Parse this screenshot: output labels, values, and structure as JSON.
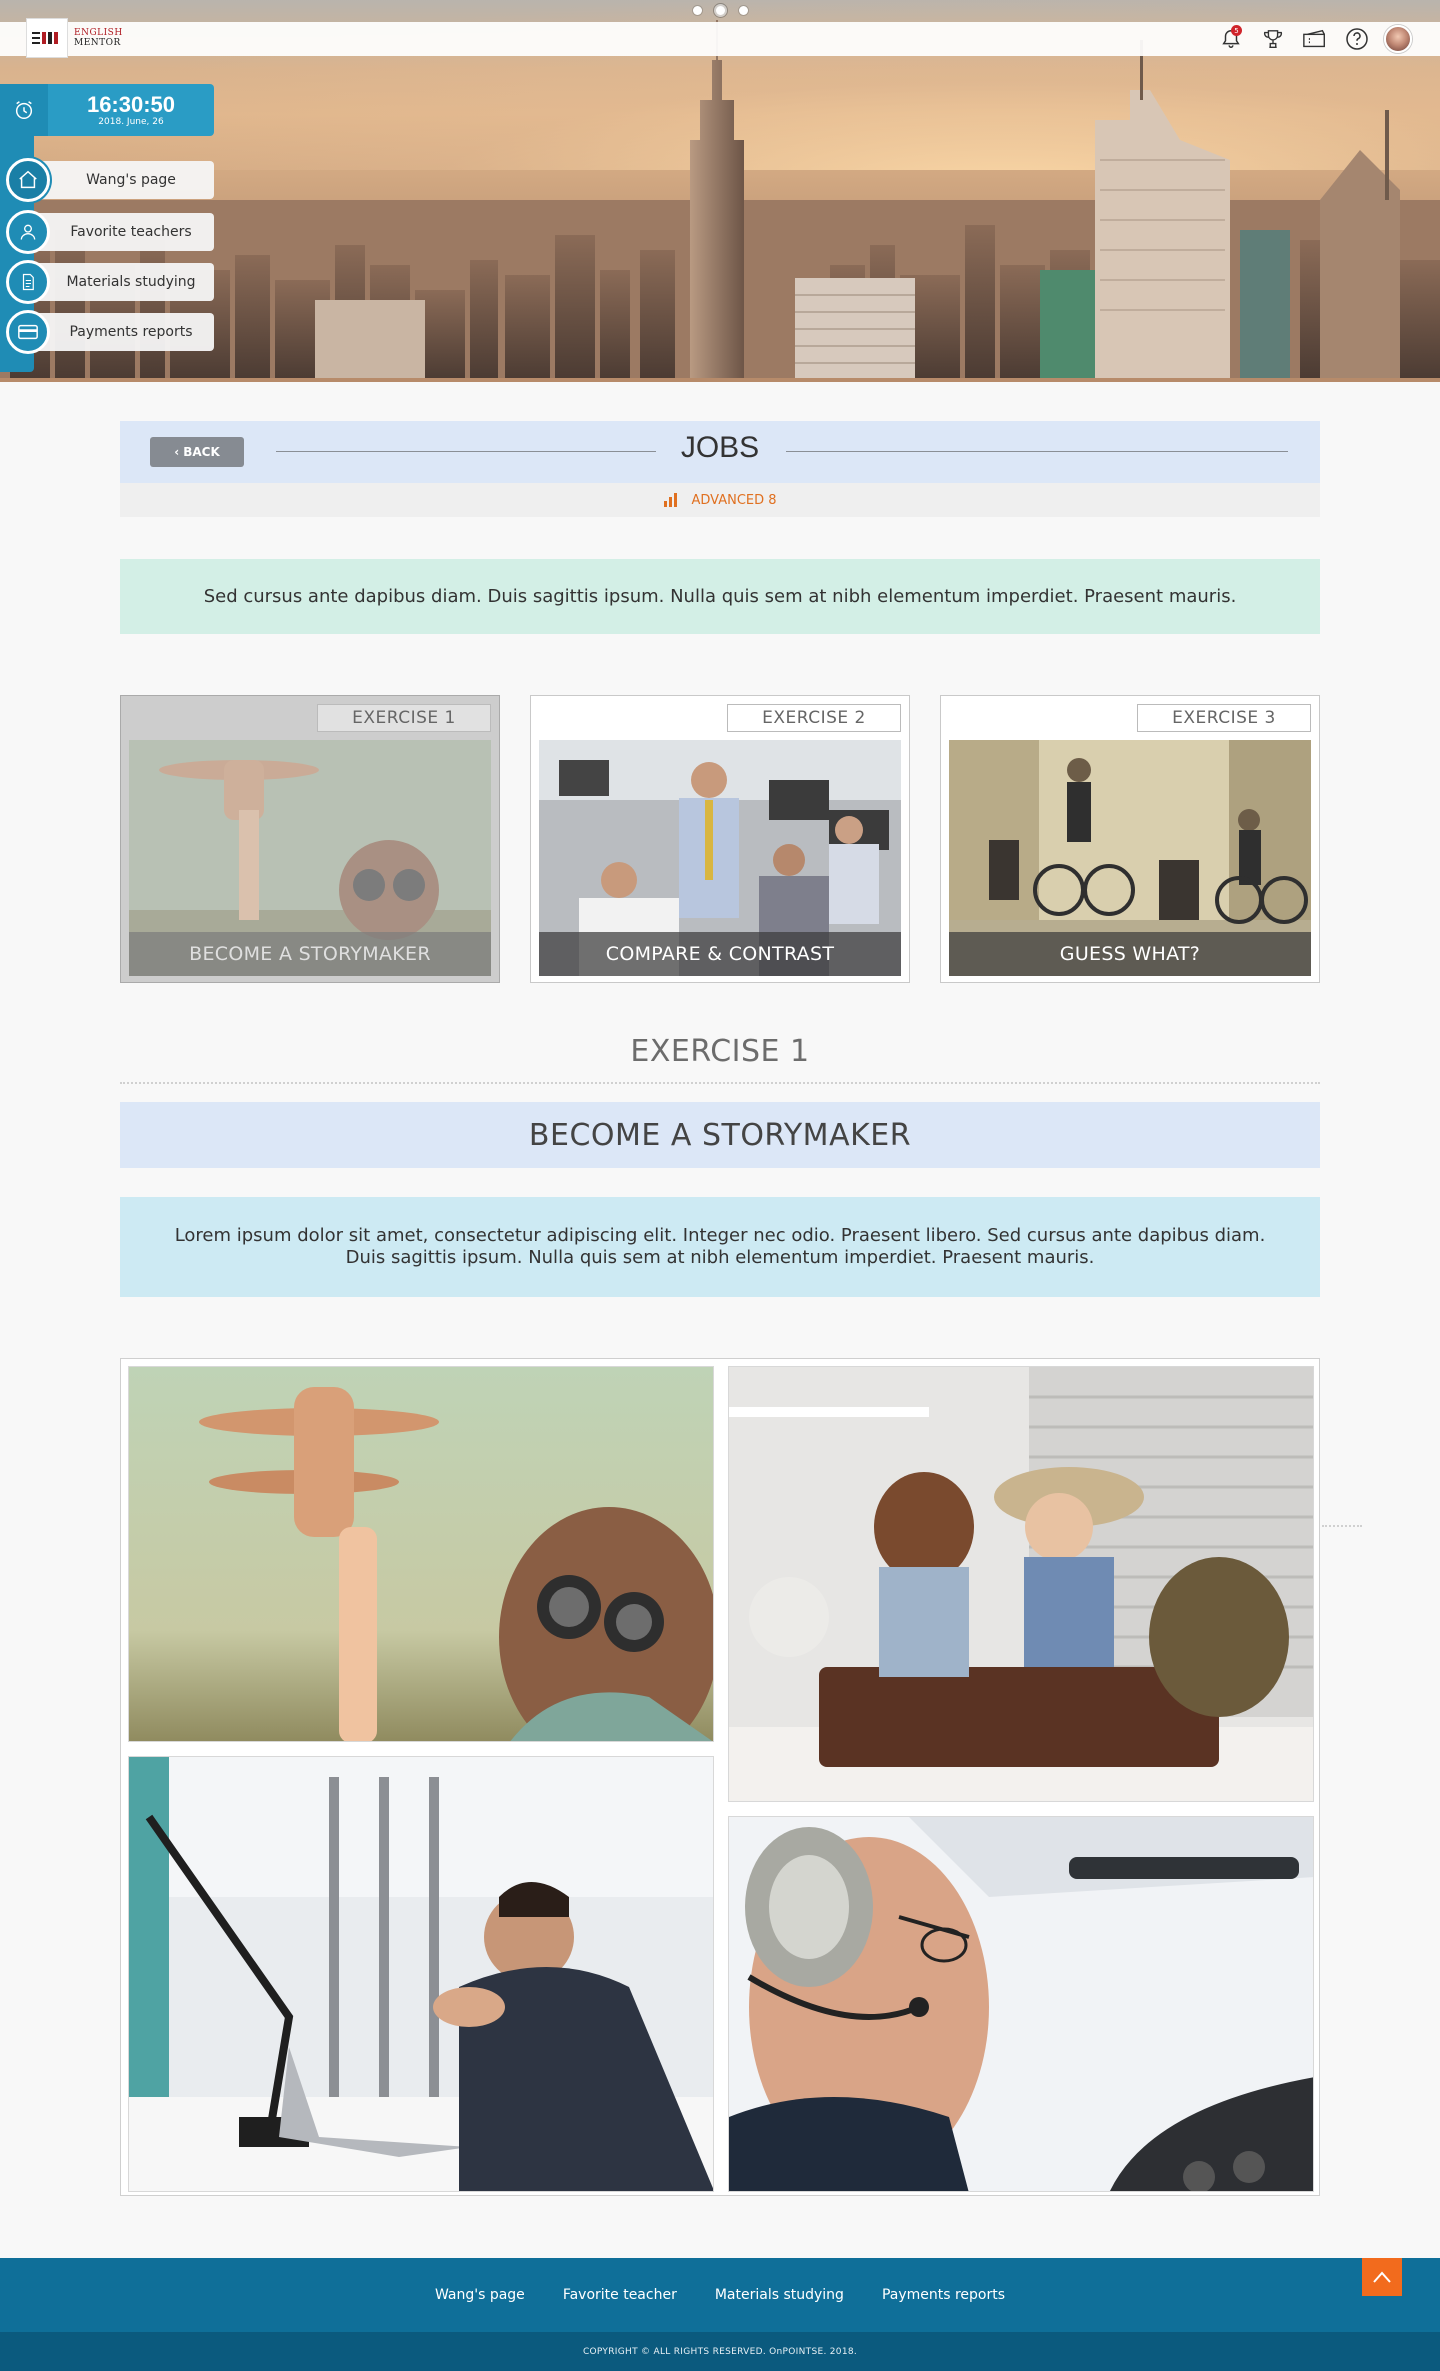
{
  "brand": {
    "line1": "ENGLISH",
    "line2": "MENTOR"
  },
  "header": {
    "notification_count": "5",
    "icons": [
      "bell-icon",
      "trophy-icon",
      "ticket-icon",
      "help-icon",
      "avatar"
    ]
  },
  "clock": {
    "time": "16:30:50",
    "date": "2018. June, 26"
  },
  "sidebar": {
    "items": [
      {
        "label": "Wang's page",
        "icon": "home-icon"
      },
      {
        "label": "Favorite teachers",
        "icon": "user-icon"
      },
      {
        "label": "Materials studying",
        "icon": "document-icon"
      },
      {
        "label": "Payments reports",
        "icon": "card-icon"
      }
    ]
  },
  "page": {
    "back_label": "BACK",
    "title": "JOBS",
    "level": "ADVANCED 8",
    "intro": "Sed cursus ante dapibus diam. Duis sagittis ipsum. Nulla quis sem at nibh elementum imperdiet. Praesent mauris."
  },
  "exercises": [
    {
      "label": "EXERCISE 1",
      "caption": "BECOME A STORYMAKER"
    },
    {
      "label": "EXERCISE 2",
      "caption": "COMPARE & CONTRAST"
    },
    {
      "label": "EXERCISE 3",
      "caption": "GUESS WHAT?"
    }
  ],
  "detail": {
    "exercise_label": "EXERCISE 1",
    "title": "BECOME A STORYMAKER",
    "desc_line1": "Lorem ipsum dolor sit amet, consectetur adipiscing elit. Integer nec odio. Praesent libero. Sed cursus ante dapibus diam.",
    "desc_line2": "Duis sagittis ipsum. Nulla quis sem at nibh elementum imperdiet. Praesent mauris."
  },
  "footer": {
    "links": [
      "Wang's page",
      "Favorite teacher",
      "Materials studying",
      "Payments reports"
    ],
    "copyright": "COPYRIGHT © ALL RIGHTS RESERVED. OnPOINTSE. 2018."
  },
  "colors": {
    "primary": "#1f8cb5",
    "footer": "#0f6f99",
    "accent": "#f26b1d",
    "level": "#e07020"
  }
}
